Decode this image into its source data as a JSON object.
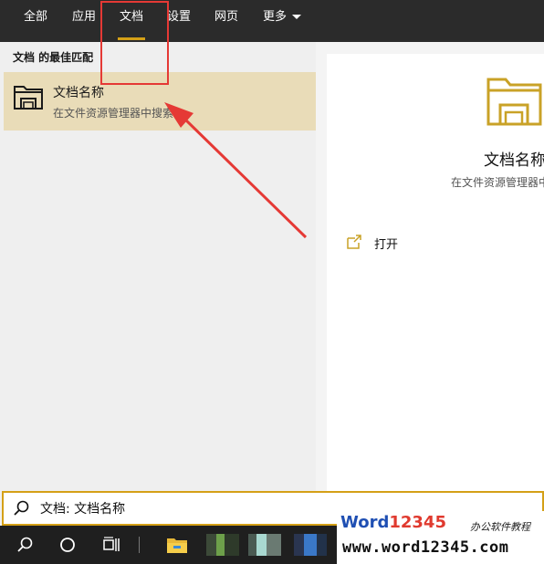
{
  "tabs": [
    {
      "label": "全部",
      "active": false
    },
    {
      "label": "应用",
      "active": false
    },
    {
      "label": "文档",
      "active": true
    },
    {
      "label": "设置",
      "active": false
    },
    {
      "label": "网页",
      "active": false
    },
    {
      "label": "更多",
      "active": false,
      "dropdown": true
    }
  ],
  "results": {
    "section_label": "文档 的最佳匹配",
    "items": [
      {
        "title": "文档名称",
        "subtitle": "在文件资源管理器中搜索",
        "icon": "folder-icon",
        "selected": true
      }
    ]
  },
  "preview": {
    "icon": "folder-icon",
    "title": "文档名称",
    "subtitle": "在文件资源管理器中搜索",
    "actions": [
      {
        "label": "打开",
        "icon": "open-icon"
      }
    ]
  },
  "search": {
    "value": "文档: 文档名称",
    "icon": "search-icon"
  },
  "taskbar": {
    "icons": [
      "search-icon",
      "cortana-circle-icon",
      "task-view-icon",
      "file-explorer-icon"
    ]
  },
  "watermark": {
    "brand_word": "Word",
    "brand_digits": "12345",
    "tagline": "办公软件教程",
    "url": "www.word12345.com"
  },
  "colors": {
    "accent": "#d4a017",
    "annotation": "#e53935",
    "tab_bar": "#2b2b2b",
    "selected_row": "#e9dcb8",
    "taskbar": "#1f1f1f"
  }
}
